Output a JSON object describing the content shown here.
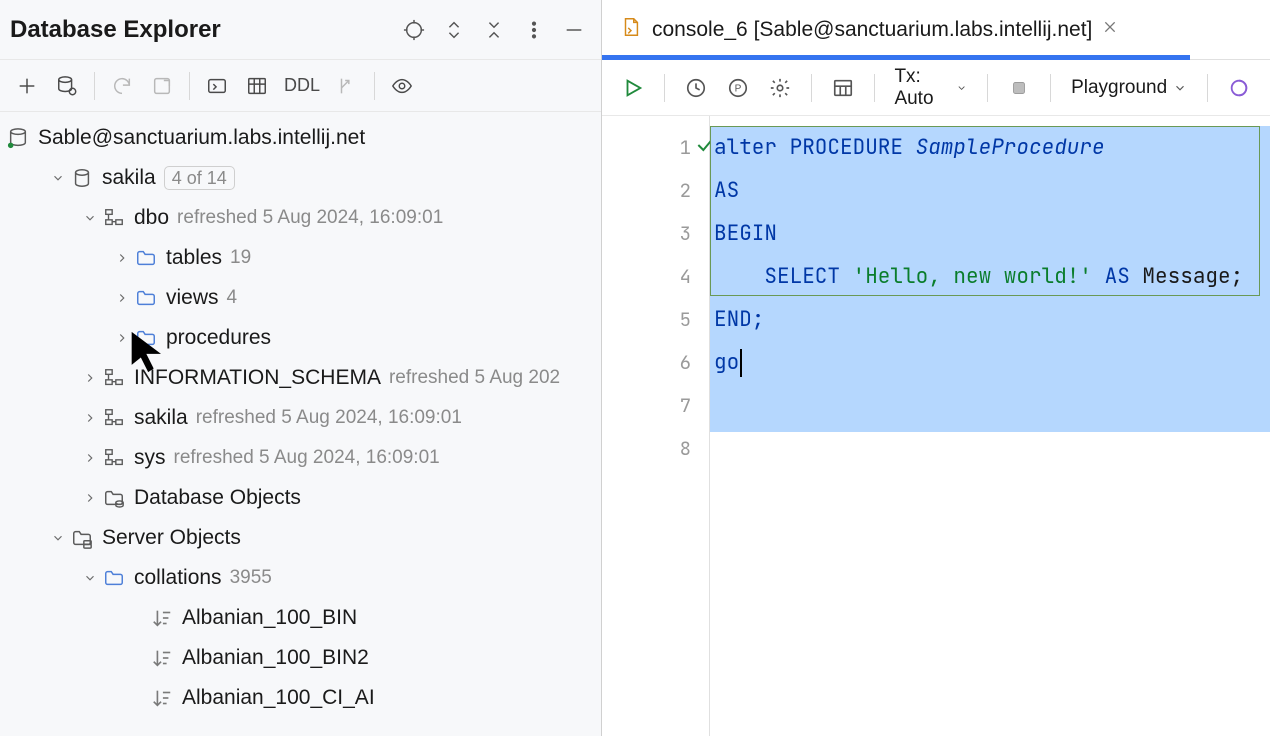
{
  "panel": {
    "title": "Database Explorer"
  },
  "datasource": {
    "name": "Sable@sanctuarium.labs.intellij.net"
  },
  "tree": {
    "db": {
      "name": "sakila",
      "count": "4 of 14"
    },
    "schemas": {
      "dbo": {
        "name": "dbo",
        "meta": "refreshed 5 Aug 2024, 16:09:01"
      },
      "info": {
        "name": "INFORMATION_SCHEMA",
        "meta": "refreshed 5 Aug 202"
      },
      "sakila": {
        "name": "sakila",
        "meta": "refreshed 5 Aug 2024, 16:09:01"
      },
      "sys": {
        "name": "sys",
        "meta": "refreshed 5 Aug 2024, 16:09:01"
      }
    },
    "dbo_children": {
      "tables": {
        "name": "tables",
        "count": "19"
      },
      "views": {
        "name": "views",
        "count": "4"
      },
      "procedures": {
        "name": "procedures"
      }
    },
    "dbobjects": "Database Objects",
    "server_objects": "Server Objects",
    "collations": {
      "name": "collations",
      "count": "3955"
    },
    "collation_items": {
      "0": "Albanian_100_BIN",
      "1": "Albanian_100_BIN2",
      "2": "Albanian_100_CI_AI"
    }
  },
  "toolbar": {
    "ddl": "DDL"
  },
  "tab": {
    "title": "console_6 [Sable@sanctuarium.labs.intellij.net]"
  },
  "editor_toolbar": {
    "tx": "Tx: Auto",
    "playground": "Playground"
  },
  "code": {
    "l1": {
      "a": "alter ",
      "b": "PROCEDURE ",
      "c": "SampleProcedure"
    },
    "l2": "AS",
    "l3": "BEGIN",
    "l4": {
      "a": "    SELECT ",
      "b": "'Hello, new world!'",
      "c": " AS ",
      "d": "Message",
      "e": ";"
    },
    "l5": "END;",
    "l6": "go"
  },
  "gutter": {
    "1": "1",
    "2": "2",
    "3": "3",
    "4": "4",
    "5": "5",
    "6": "6",
    "7": "7",
    "8": "8"
  }
}
